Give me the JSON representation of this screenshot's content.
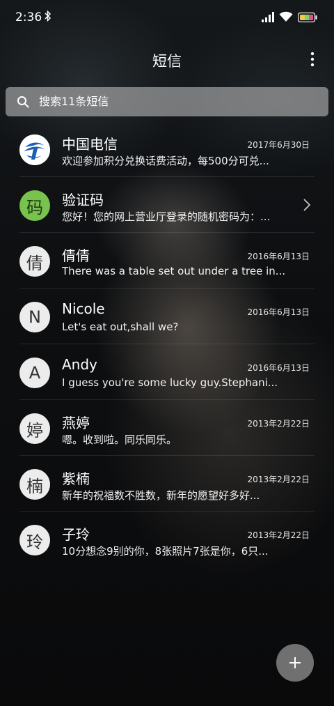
{
  "status_bar": {
    "time": "2:36",
    "icons": [
      "bluetooth-icon",
      "signal-icon",
      "wifi-icon",
      "battery-icon"
    ]
  },
  "header": {
    "title": "短信",
    "menu_icon": "more-vertical-icon"
  },
  "search": {
    "placeholder": "搜索11条短信",
    "icon": "search-icon"
  },
  "conversations": [
    {
      "name": "中国电信",
      "date": "2017年6月30日",
      "preview": "欢迎参加积分兑换话费活动，每500分可兑...",
      "avatar": "telecom-logo"
    },
    {
      "name": "验证码",
      "date": "",
      "preview": "您好！您的网上营业厅登录的随机密码为：...",
      "avatar_char": "码"
    },
    {
      "name": "倩倩",
      "date": "2016年6月13日",
      "preview": "There was a table set out under a tree in...",
      "avatar_char": "倩"
    },
    {
      "name": "Nicole",
      "date": "2016年6月13日",
      "preview": "Let's eat out,shall we?",
      "avatar_char": "N"
    },
    {
      "name": "Andy",
      "date": "2016年6月13日",
      "preview": "I guess you're some lucky guy.Stephani...",
      "avatar_char": "A"
    },
    {
      "name": "燕婷",
      "date": "2013年2月22日",
      "preview": "嗯。收到啦。同乐同乐。",
      "avatar_char": "婷"
    },
    {
      "name": "紫楠",
      "date": "2013年2月22日",
      "preview": "新年的祝福数不胜数，新年的愿望好多好...",
      "avatar_char": "楠"
    },
    {
      "name": "子玲",
      "date": "2013年2月22日",
      "preview": "10分想念9别的你，8张照片7张是你，6只...",
      "avatar_char": "玲"
    }
  ],
  "fab": {
    "icon": "plus-icon"
  },
  "colors": {
    "code_avatar": "#78c24e",
    "telecom_blue": "#1a5fb4",
    "search_bg": "#b4b4b4"
  }
}
